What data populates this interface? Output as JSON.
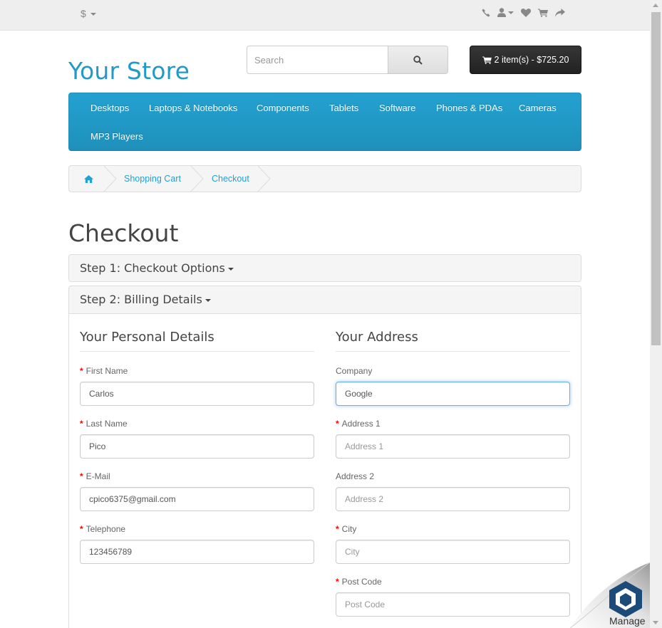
{
  "topbar": {
    "currency": "$",
    "icons": [
      "phone-icon",
      "user-icon",
      "heart-icon",
      "cart-icon",
      "share-icon"
    ]
  },
  "header": {
    "logo": "Your Store",
    "search_placeholder": "Search",
    "cart_label": "2 item(s) - $725.20"
  },
  "menu": {
    "items": [
      "Desktops",
      "Laptops & Notebooks",
      "Components",
      "Tablets",
      "Software",
      "Phones & PDAs",
      "Cameras",
      "MP3 Players"
    ]
  },
  "breadcrumb": {
    "items": [
      "Shopping Cart",
      "Checkout"
    ]
  },
  "page": {
    "title": "Checkout",
    "step1": "Step 1: Checkout Options",
    "step2": "Step 2: Billing Details"
  },
  "personal": {
    "legend": "Your Personal Details",
    "first_name_label": "First Name",
    "first_name_value": "Carlos",
    "last_name_label": "Last Name",
    "last_name_value": "Pico",
    "email_label": "E-Mail",
    "email_value": "cpico6375@gmail.com",
    "telephone_label": "Telephone",
    "telephone_value": "123456789"
  },
  "address": {
    "legend": "Your Address",
    "company_label": "Company",
    "company_value": "Google",
    "address1_label": "Address 1",
    "address1_placeholder": "Address 1",
    "address2_label": "Address 2",
    "address2_placeholder": "Address 2",
    "city_label": "City",
    "city_placeholder": "City",
    "postcode_label": "Post Code",
    "postcode_placeholder": "Post Code"
  },
  "widget": {
    "manage_label": "Manage"
  },
  "colors": {
    "brand": "#229ac8",
    "menu": "#229ac8",
    "cart_button": "#303030",
    "required": "#ff0000"
  }
}
